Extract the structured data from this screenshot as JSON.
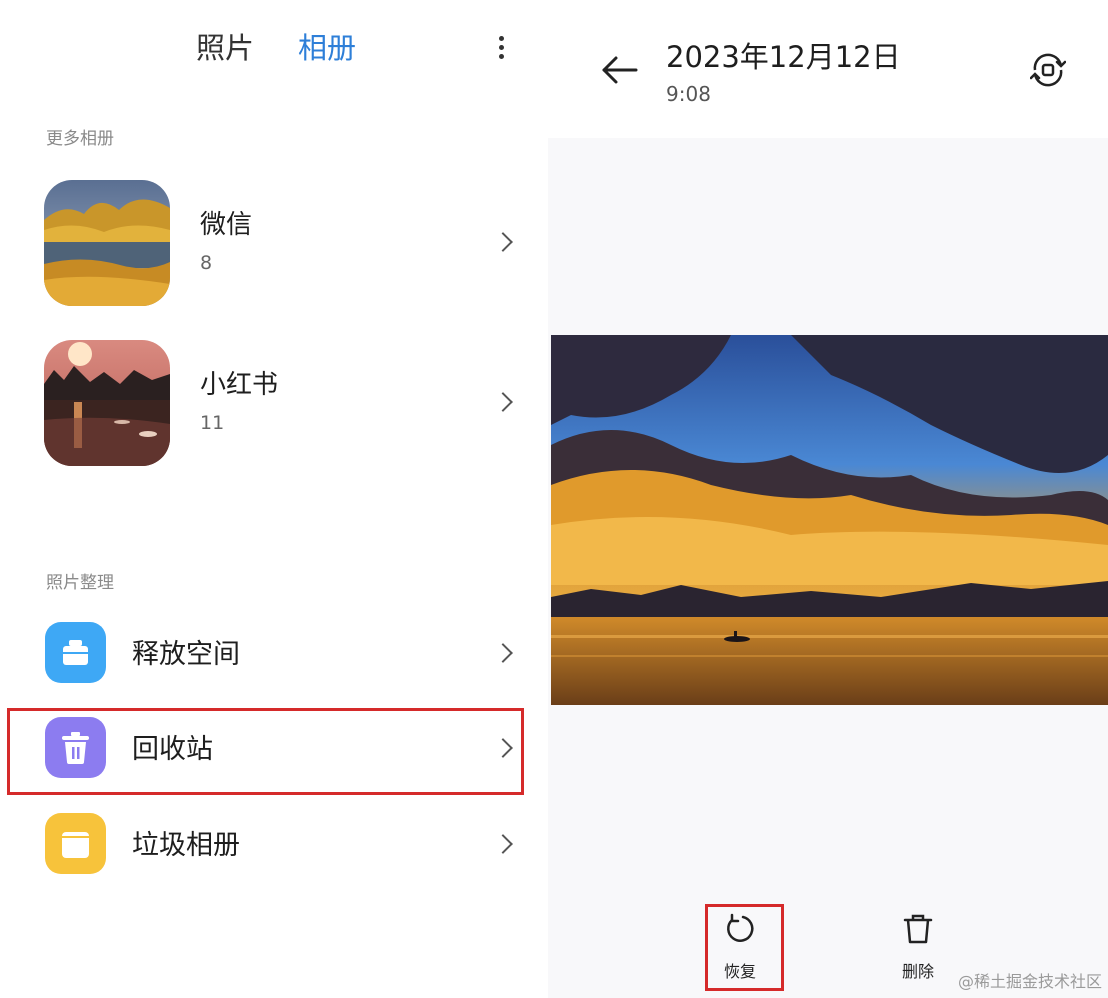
{
  "left_panel": {
    "tabs": [
      {
        "label": "照片",
        "active": false
      },
      {
        "label": "相册",
        "active": true
      }
    ],
    "more_albums_label": "更多相册",
    "albums": [
      {
        "name": "微信",
        "count": "8"
      },
      {
        "name": "小红书",
        "count": "11"
      }
    ],
    "organize_label": "照片整理",
    "tools": [
      {
        "label": "释放空间",
        "icon": "cleanup-icon",
        "color": "#3ea8f5"
      },
      {
        "label": "回收站",
        "icon": "recycle-bin-icon",
        "color": "#8c7cf0"
      },
      {
        "label": "垃圾相册",
        "icon": "junk-album-icon",
        "color": "#f7c33b"
      }
    ],
    "highlighted_item": "回收站"
  },
  "right_panel": {
    "date": "2023年12月12日",
    "time": "9:08",
    "actions": [
      {
        "label": "恢复",
        "icon": "restore-icon",
        "highlighted": true
      },
      {
        "label": "删除",
        "icon": "trash-icon",
        "highlighted": false
      }
    ]
  },
  "watermark": "@稀土掘金技术社区",
  "colors": {
    "accent": "#2e7fd8",
    "highlight_box": "#d52a2a"
  }
}
